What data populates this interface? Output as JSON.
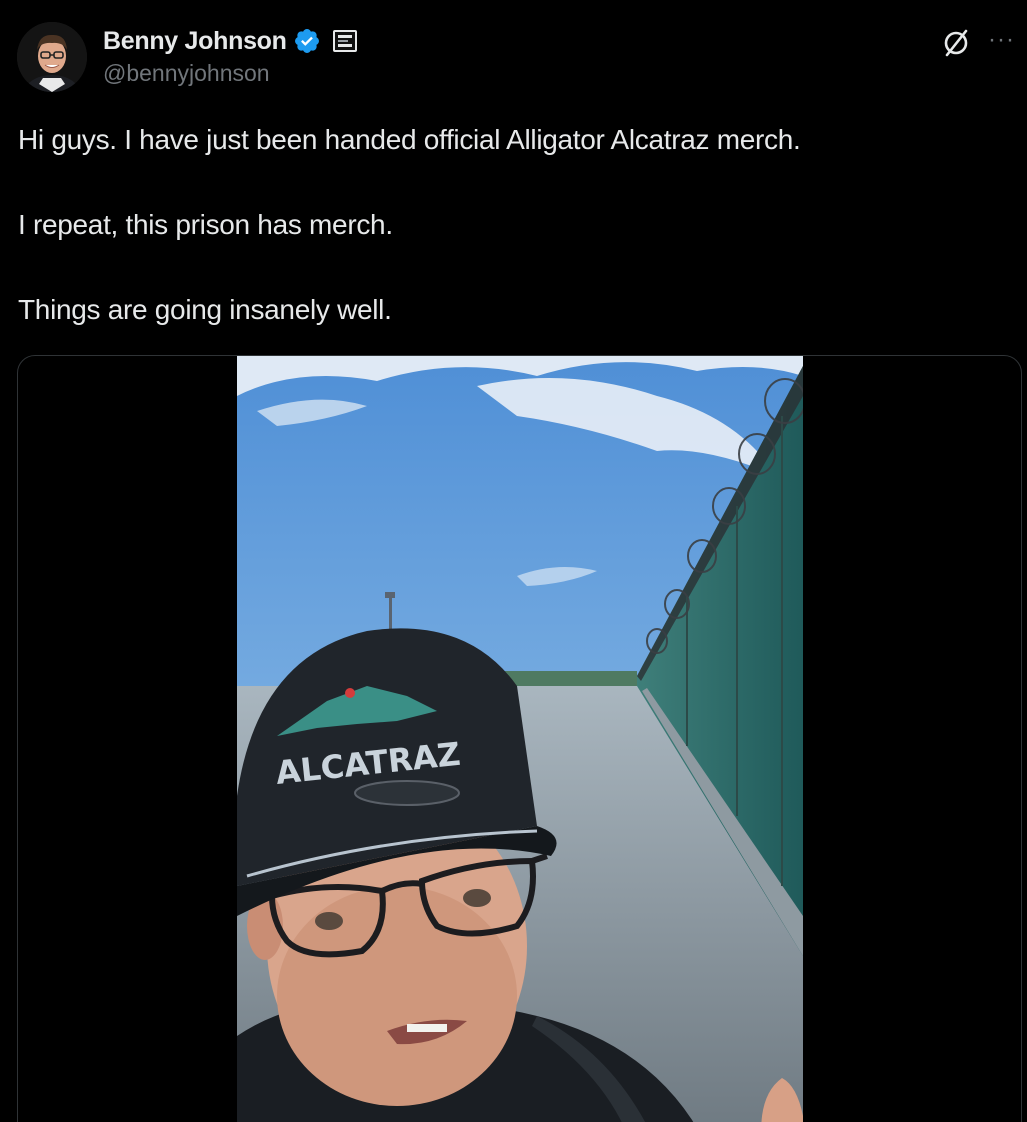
{
  "tweet": {
    "author": {
      "display_name": "Benny Johnson",
      "handle": "@bennyjohnson",
      "verified": true,
      "verified_icon": "verified-badge-icon",
      "affiliate_icon": "affiliate-badge-icon"
    },
    "text": {
      "line1": "Hi guys. I have just been handed official Alligator Alcatraz merch.",
      "line2": "I repeat, this prison has merch.",
      "line3": "Things are going insanely well."
    },
    "header_icons": {
      "grok": "grok-icon",
      "more": "more-icon",
      "more_glyph": "···"
    },
    "media": {
      "type": "video",
      "cap_text": "ALCATRAZ"
    }
  },
  "colors": {
    "background": "#000000",
    "text_primary": "#e7e9ea",
    "text_secondary": "#71767b",
    "verified_blue": "#1d9bf0",
    "card_border": "#2f3336"
  }
}
